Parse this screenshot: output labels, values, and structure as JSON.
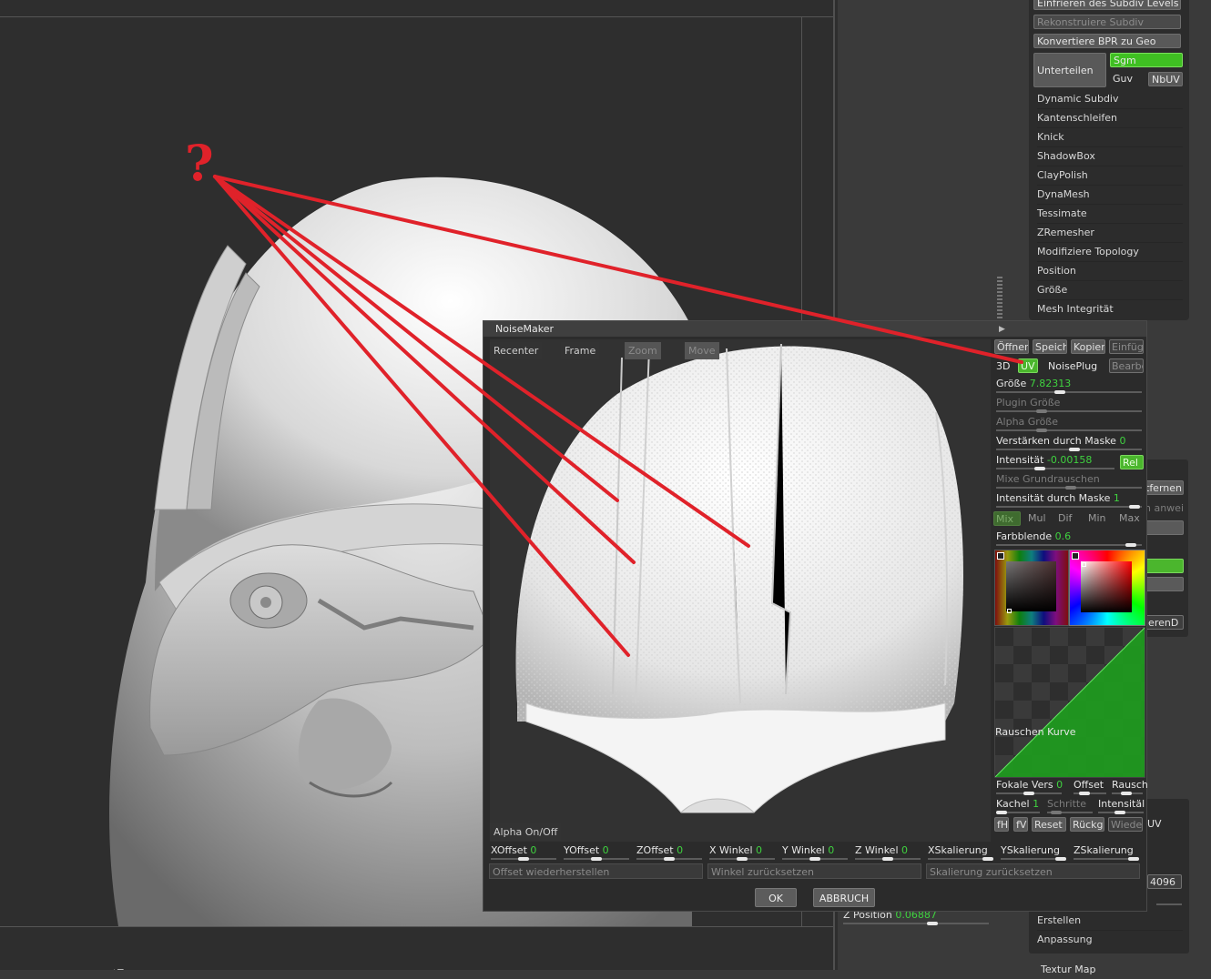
{
  "right_menu": {
    "top_cut_label": "Einfrieren des Subdiv Levels",
    "rekonstruiere": "Rekonstruiere Subdiv",
    "konvertiere": "Konvertiere BPR zu Geo",
    "unterteilen": "Unterteilen",
    "sgm": "Sgm",
    "guv": "Guv",
    "nbuv": "NbUV",
    "items": [
      "Dynamic Subdiv",
      "Kantenschleifen",
      "Knick",
      "ShadowBox",
      "ClayPolish",
      "DynaMesh",
      "Tessimate",
      "ZRemesher",
      "Modifiziere Topology",
      "Position",
      "Größe",
      "Mesh Integrität"
    ]
  },
  "right_mid": {
    "entfernen": "tfernen",
    "anwenden": "n anwei",
    "ierend": "ierenD"
  },
  "right_low": {
    "uv": "UV",
    "size_4096": "4096",
    "z_position_label": "Z Position",
    "z_position_value": "0.06887",
    "erstellen": "Erstellen",
    "anpassung": "Anpassung",
    "textur_map": "Textur Map"
  },
  "annotation": {
    "mark": "?",
    "color": "#e0222a"
  },
  "dialog": {
    "title": "NoiseMaker",
    "preview_buttons": {
      "recenter": "Recenter",
      "frame": "Frame",
      "zoom": "Zoom",
      "move": "Move"
    },
    "alpha_toggle": "Alpha On/Off",
    "top_buttons": [
      "Öffnen",
      "Speich",
      "Kopier",
      "Einfüg"
    ],
    "mode_3d": "3D",
    "mode_uv": "UV",
    "noiseplug": "NoisePlug",
    "bearbeiten": "Bearbe",
    "groesse_label": "Größe",
    "groesse_value": "7.82313",
    "plugin_groesse": "Plugin Größe",
    "alpha_groesse": "Alpha Größe",
    "verstaerken_label": "Verstärken durch Maske",
    "verstaerken_value": "0",
    "intensitaet_label": "Intensität",
    "intensitaet_value": "-0.00158",
    "rel": "Rel",
    "mixe_grundrauschen": "Mixe Grundrauschen",
    "intensitaet_maske_label": "Intensität durch Maske",
    "intensitaet_maske_value": "1",
    "blend_modes": [
      "Mix",
      "Mul",
      "Dif",
      "Min",
      "Max"
    ],
    "farbblende_label": "Farbblende",
    "farbblende_value": "0.6",
    "rauschen_kurve": "Rauschen Kurve",
    "fokale_label": "Fokale Vers",
    "fokale_value": "0",
    "offset": "Offset",
    "rausch": "Rausch",
    "kachel_label": "Kachel",
    "kachel_value": "1",
    "schritte": "Schritte",
    "intensitaet_short": "Intensitäl",
    "small_buttons": [
      "fH",
      "fV",
      "Reset",
      "Rückgä",
      "Wieder"
    ],
    "offsets": [
      {
        "label": "XOffset",
        "value": "0"
      },
      {
        "label": "YOffset",
        "value": "0"
      },
      {
        "label": "ZOffset",
        "value": "0"
      },
      {
        "label": "X Winkel",
        "value": "0"
      },
      {
        "label": "Y Winkel",
        "value": "0"
      },
      {
        "label": "Z Winkel",
        "value": "0"
      },
      {
        "label": "XSkalierung",
        "value": ""
      },
      {
        "label": "YSkalierung",
        "value": ""
      },
      {
        "label": "ZSkalierung",
        "value": ""
      }
    ],
    "reset_offset": "Offset wiederherstellen",
    "reset_winkel": "Winkel zurücksetzen",
    "reset_skalierung": "Skalierung zurücksetzen",
    "ok": "OK",
    "abbruch": "ABBRUCH"
  }
}
